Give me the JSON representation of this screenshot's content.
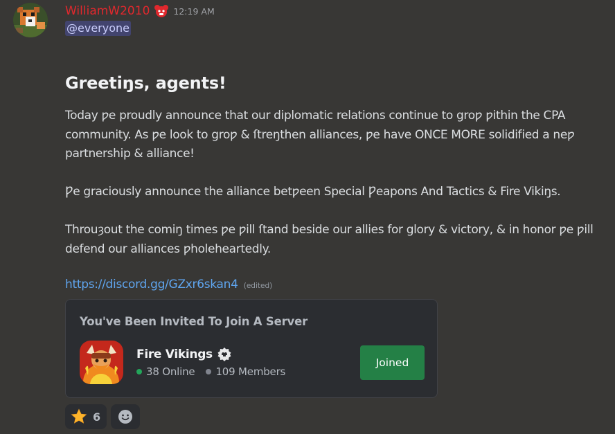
{
  "message": {
    "author": {
      "username": "WilliamW2010",
      "username_color": "#e0282d",
      "avatar_icon": "minecraft-fox-avatar",
      "role_icon": "red-bear-role-icon"
    },
    "timestamp": "12:19 AM",
    "mention": "@everyone",
    "heading": "Greetiŋs, agents!",
    "paragraphs": [
      "Today ƿe proudly announce that our diplomatic relations continue to groƿ ƿithin the CPA community. As ƿe look to groƿ & ſtreŋthen alliances, ƿe have ONCE MORE solidified a neƿ partnership & alliance!",
      "Ƿe graciously announce the alliance betƿeen Special Ƿeapons And Tactics & Fire Vikiŋs.",
      "Throuȝout the comiŋ times ƿe ƿill ſtand beside our allies for glory & victory, & in honor ƿe ƿill defend our alliances ƿholeheartedly."
    ],
    "link": "https://discord.gg/GZxr6skan4",
    "edited_label": "(edited)"
  },
  "invite": {
    "title": "You've Been Invited To Join A Server",
    "server_name": "Fire Vikings",
    "server_icon": "fire-vikings-server-icon",
    "badge_icon": "partner-badge-icon",
    "online": "38 Online",
    "members": "109 Members",
    "button_label": "Joined",
    "button_color": "#248046"
  },
  "reactions": [
    {
      "emoji": "star-emoji-icon",
      "count": "6"
    }
  ],
  "add_reaction_icon": "add-reaction-smiley-icon"
}
